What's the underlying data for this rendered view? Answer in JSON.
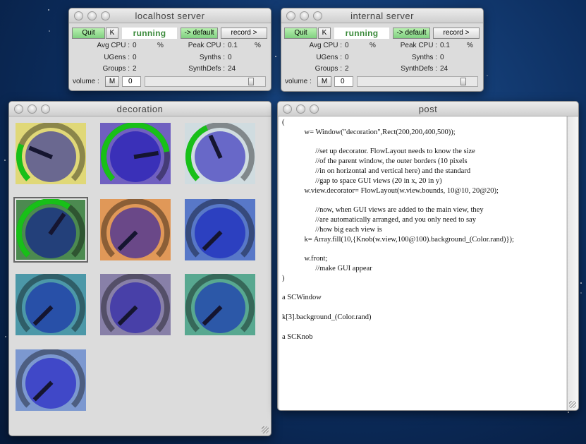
{
  "servers": [
    {
      "title": "localhost server",
      "quit": "Quit",
      "kill": "K",
      "status": "running",
      "default": "-> default",
      "record": "record >",
      "avg_cpu_label": "Avg CPU :",
      "avg_cpu": "0",
      "pct": "%",
      "peak_cpu_label": "Peak CPU :",
      "peak_cpu": "0.1",
      "pct2": "%",
      "ugens_label": "UGens :",
      "ugens": "0",
      "synths_label": "Synths :",
      "synths": "0",
      "groups_label": "Groups :",
      "groups": "2",
      "synthdefs_label": "SynthDefs :",
      "synthdefs": "24",
      "volume_label": "volume :",
      "mute": "M",
      "volume": "0",
      "volume_slider": 0.9
    },
    {
      "title": "internal server",
      "quit": "Quit",
      "kill": "K",
      "status": "running",
      "default": "-> default",
      "record": "record >",
      "avg_cpu_label": "Avg CPU :",
      "avg_cpu": "0",
      "pct": "%",
      "peak_cpu_label": "Peak CPU :",
      "peak_cpu": "0.1",
      "pct2": "%",
      "ugens_label": "UGens :",
      "ugens": "0",
      "synths_label": "Synths :",
      "synths": "0",
      "groups_label": "Groups :",
      "groups": "2",
      "synthdefs_label": "SynthDefs :",
      "synthdefs": "24",
      "volume_label": "volume :",
      "mute": "M",
      "volume": "0",
      "volume_slider": 0.9
    }
  ],
  "decoration": {
    "title": "decoration",
    "knobs": [
      {
        "background": "#e0d878",
        "knob": "#6a6890",
        "value": 0.25
      },
      {
        "background": "#7060c0",
        "knob": "#3a30b8",
        "value": 0.8
      },
      {
        "background": "#d0dce0",
        "knob": "#6868c8",
        "value": 0.41
      },
      {
        "background": "#4c8a50",
        "knob": "#23407a",
        "value": 0.63,
        "focused": true
      },
      {
        "background": "#e09858",
        "knob": "#6a4888",
        "value": 0
      },
      {
        "background": "#5878c8",
        "knob": "#2c40c0",
        "value": 0
      },
      {
        "background": "#4c98a8",
        "knob": "#2850a8",
        "value": 0
      },
      {
        "background": "#8880a8",
        "knob": "#4840a8",
        "value": 0
      },
      {
        "background": "#58a890",
        "knob": "#2c58a8",
        "value": 0
      },
      {
        "background": "#7c98d0",
        "knob": "#4048c8",
        "value": 0
      }
    ],
    "accent": "#18c018"
  },
  "post": {
    "title": "post",
    "text": "(\n\t\tw= Window(\"decoration\",Rect(200,200,400,500));\n\n\t\t\t//set up decorator. FlowLayout needs to know the size\n\t\t\t//of the parent window, the outer borders (10 pixels\n\t\t\t//in on horizontal and vertical here) and the standard\n\t\t\t//gap to space GUI views (20 in x, 20 in y)\n\t\tw.view.decorator= FlowLayout(w.view.bounds, 10@10, 20@20);\n\n\t\t\t//now, when GUI views are added to the main view, they\n\t\t\t//are automatically arranged, and you only need to say\n\t\t\t//how big each view is\n\t\tk= Array.fill(10,{Knob(w.view,100@100).background_(Color.rand)});\n\n\t\tw.front;\n\t\t\t//make GUI appear\n)\n\na SCWindow\n\nk[3].background_(Color.rand)\n\na SCKnob"
  }
}
